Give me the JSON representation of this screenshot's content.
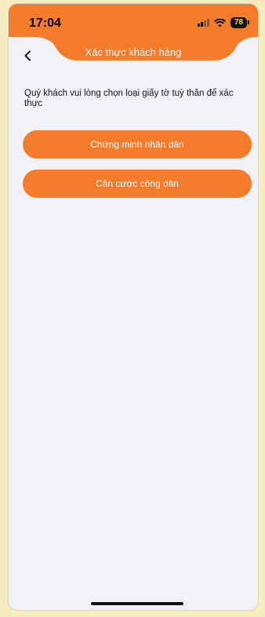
{
  "status_bar": {
    "time": "17:04",
    "battery": "78",
    "icons": [
      "signal-icon",
      "wifi-icon",
      "battery-icon"
    ]
  },
  "header": {
    "title": "Xác thực khách hàng",
    "back_icon": "chevron-left-icon"
  },
  "instruction": "Quý khách vui lòng chọn loại giấy tờ tuỳ thân để xác thực",
  "options": [
    {
      "label": "Chứng minh nhân dân"
    },
    {
      "label": "Căn cước công dân"
    }
  ],
  "colors": {
    "accent": "#f47b2a",
    "background": "#f2f1f6",
    "outer_frame": "#f7ecc0"
  }
}
